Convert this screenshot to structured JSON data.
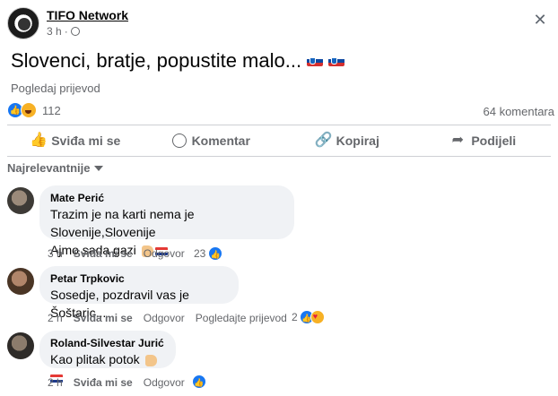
{
  "post": {
    "page_name": "TIFO Network",
    "time": "3 h",
    "separator": "·",
    "text": "Slovenci, bratje, popustite malo...",
    "translate_label": "Pogledaj prijevod",
    "reaction_count": "112",
    "comment_count": "64 komentara"
  },
  "actions": {
    "like": "Sviđa mi se",
    "comment": "Komentar",
    "copy": "Kopiraj",
    "share": "Podijeli"
  },
  "sort_label": "Najrelevantnije",
  "comments": [
    {
      "author": "Mate Perić",
      "line1": "Trazim je na karti nema je Slovenije,Slovenije",
      "line2": "Ajmo sada gazi",
      "time": "3 h",
      "like": "Sviđa mi se",
      "reply": "Odgovor",
      "reactions": "23"
    },
    {
      "author": "Petar Trpkovic",
      "line1": "Sosedje, pozdravil vas je Šoštaric...",
      "time": "2 h",
      "like": "Sviđa mi se",
      "reply": "Odgovor",
      "translate": "Pogledajte prijevod",
      "reactions": "2"
    },
    {
      "author": "Roland-Silvestar Jurić",
      "line1": "Kao plitak potok",
      "time": "2 h",
      "like": "Sviđa mi se",
      "reply": "Odgovor"
    }
  ],
  "colors": {
    "like_blue": "#1877f2",
    "secondary_text": "#65676b",
    "bubble_bg": "#f0f2f5"
  }
}
